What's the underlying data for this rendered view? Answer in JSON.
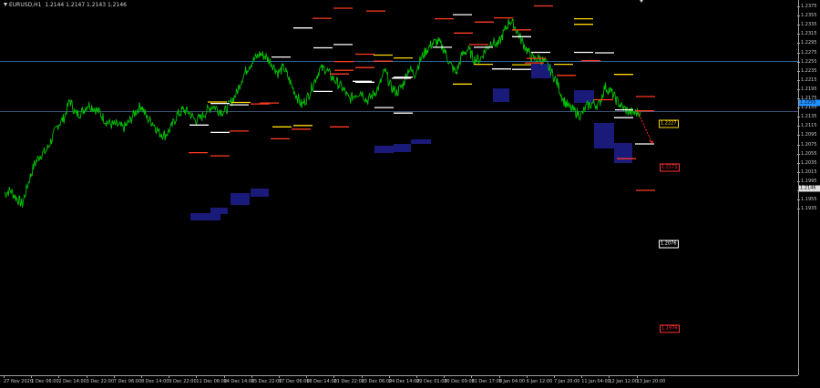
{
  "header": {
    "symbol": "EURUSD,H1",
    "ohlc": "1.2144 1.2147 1.2143 1.2146"
  },
  "colors": {
    "background": "#000000",
    "candle": "#00c000",
    "zone": "#1a1a7a",
    "level_red": "#ff3b1f",
    "level_white": "#ffffff",
    "level_yellow": "#ffd700",
    "hline": "#3a7fc0",
    "projection": "#ff2a2a"
  },
  "price_axis": {
    "ticks": [
      "1.2375",
      "1.2355",
      "1.2335",
      "1.2315",
      "1.2295",
      "1.2275",
      "1.2255",
      "1.2235",
      "1.2215",
      "1.2195",
      "1.2175",
      "1.2155",
      "1.2135",
      "1.2115",
      "1.2095",
      "1.2075",
      "1.2055",
      "1.2035",
      "1.2015",
      "1.1995",
      "1.1975",
      "1.1955",
      "1.1935"
    ],
    "current_price": "1.2146",
    "blue_line_price": "1.2255"
  },
  "time_axis": {
    "labels": [
      "27 Nov 2020",
      "1 Dec 06:00",
      "2 Dec 14:00",
      "3 Dec 22:00",
      "7 Dec 06:00",
      "8 Dec 14:00",
      "9 Dec 22:00",
      "11 Dec 06:00",
      "14 Dec 14:00",
      "15 Dec 22:00",
      "17 Dec 06:00",
      "18 Dec 14:00",
      "21 Dec 22:00",
      "23 Dec 06:00",
      "24 Dec 14:00",
      "29 Dec 01:00",
      "30 Dec 09:00",
      "31 Dec 17:00",
      "5 Jan 04:00",
      "6 Jan 12:00",
      "7 Jan 20:00",
      "11 Jan 04:00",
      "12 Jan 12:00",
      "13 Jan 20:00"
    ]
  },
  "annotations": {
    "tag_yellow": "1.2227",
    "tag_red": "1.2171",
    "tag_white": "1.2076",
    "tag_red_low": "1.1976"
  },
  "chart_data": {
    "type": "line",
    "title": "EURUSD,H1",
    "ylim": [
      1.1925,
      1.2385
    ],
    "series": [
      {
        "name": "EURUSD,H1",
        "y": [
          1.1968,
          1.1975,
          1.1958,
          1.1945,
          1.1992,
          1.2031,
          1.2052,
          1.206,
          1.2088,
          1.2118,
          1.2132,
          1.2171,
          1.214,
          1.2145,
          1.2162,
          1.2155,
          1.2144,
          1.2126,
          1.2118,
          1.2117,
          1.211,
          1.2124,
          1.2145,
          1.216,
          1.2131,
          1.2122,
          1.21,
          1.2095,
          1.211,
          1.2138,
          1.215,
          1.2145,
          1.2128,
          1.2132,
          1.2147,
          1.216,
          1.215,
          1.2145,
          1.2165,
          1.2185,
          1.222,
          1.2244,
          1.2259,
          1.2272,
          1.2265,
          1.225,
          1.223,
          1.2242,
          1.2212,
          1.2184,
          1.216,
          1.2178,
          1.2208,
          1.2238,
          1.224,
          1.2222,
          1.2209,
          1.2195,
          1.2172,
          1.2184,
          1.219,
          1.217,
          1.2183,
          1.22,
          1.2236,
          1.22,
          1.2188,
          1.2204,
          1.224,
          1.2228,
          1.226,
          1.228,
          1.2295,
          1.2298,
          1.228,
          1.2248,
          1.223,
          1.227,
          1.2282,
          1.226,
          1.226,
          1.2282,
          1.23,
          1.229,
          1.2318,
          1.2345,
          1.2328,
          1.23,
          1.2278,
          1.226,
          1.2263,
          1.2252,
          1.2233,
          1.2208,
          1.2172,
          1.2155,
          1.2146,
          1.2138,
          1.2158,
          1.2164,
          1.216,
          1.22,
          1.219,
          1.217,
          1.2155,
          1.2146,
          1.2143,
          1.2146
        ]
      }
    ],
    "projection": {
      "from": 1.2146,
      "to": 1.2076
    },
    "levels": {
      "red": [
        1.2057,
        1.205,
        1.2104,
        1.2163,
        1.2165,
        1.2087,
        1.2108,
        1.2228,
        1.2113,
        1.2236,
        1.2255,
        1.2371,
        1.2349,
        1.2365,
        1.2242,
        1.2271,
        1.2256,
        1.2348,
        1.2317,
        1.2292,
        1.2341,
        1.235,
        1.2324,
        1.2252,
        1.2262,
        1.2376,
        1.2225,
        1.2257,
        1.2172,
        1.2044,
        1.2148,
        1.1975,
        1.2179
      ],
      "white": [
        1.2117,
        1.2101,
        1.2164,
        1.2161,
        1.2265,
        1.2328,
        1.2292,
        1.2285,
        1.2212,
        1.221,
        1.2155,
        1.2219,
        1.2286,
        1.2357,
        1.2286,
        1.2239,
        1.2238,
        1.2275,
        1.2275,
        1.2309,
        1.219,
        1.2221,
        1.2274,
        1.2143,
        1.2133,
        1.2076
      ],
      "yellow": [
        1.2167,
        1.2166,
        1.2113,
        1.2116,
        1.2269,
        1.2263,
        1.2206,
        1.2249,
        1.2248,
        1.2348,
        1.2336,
        1.2249,
        1.2227
      ]
    }
  }
}
